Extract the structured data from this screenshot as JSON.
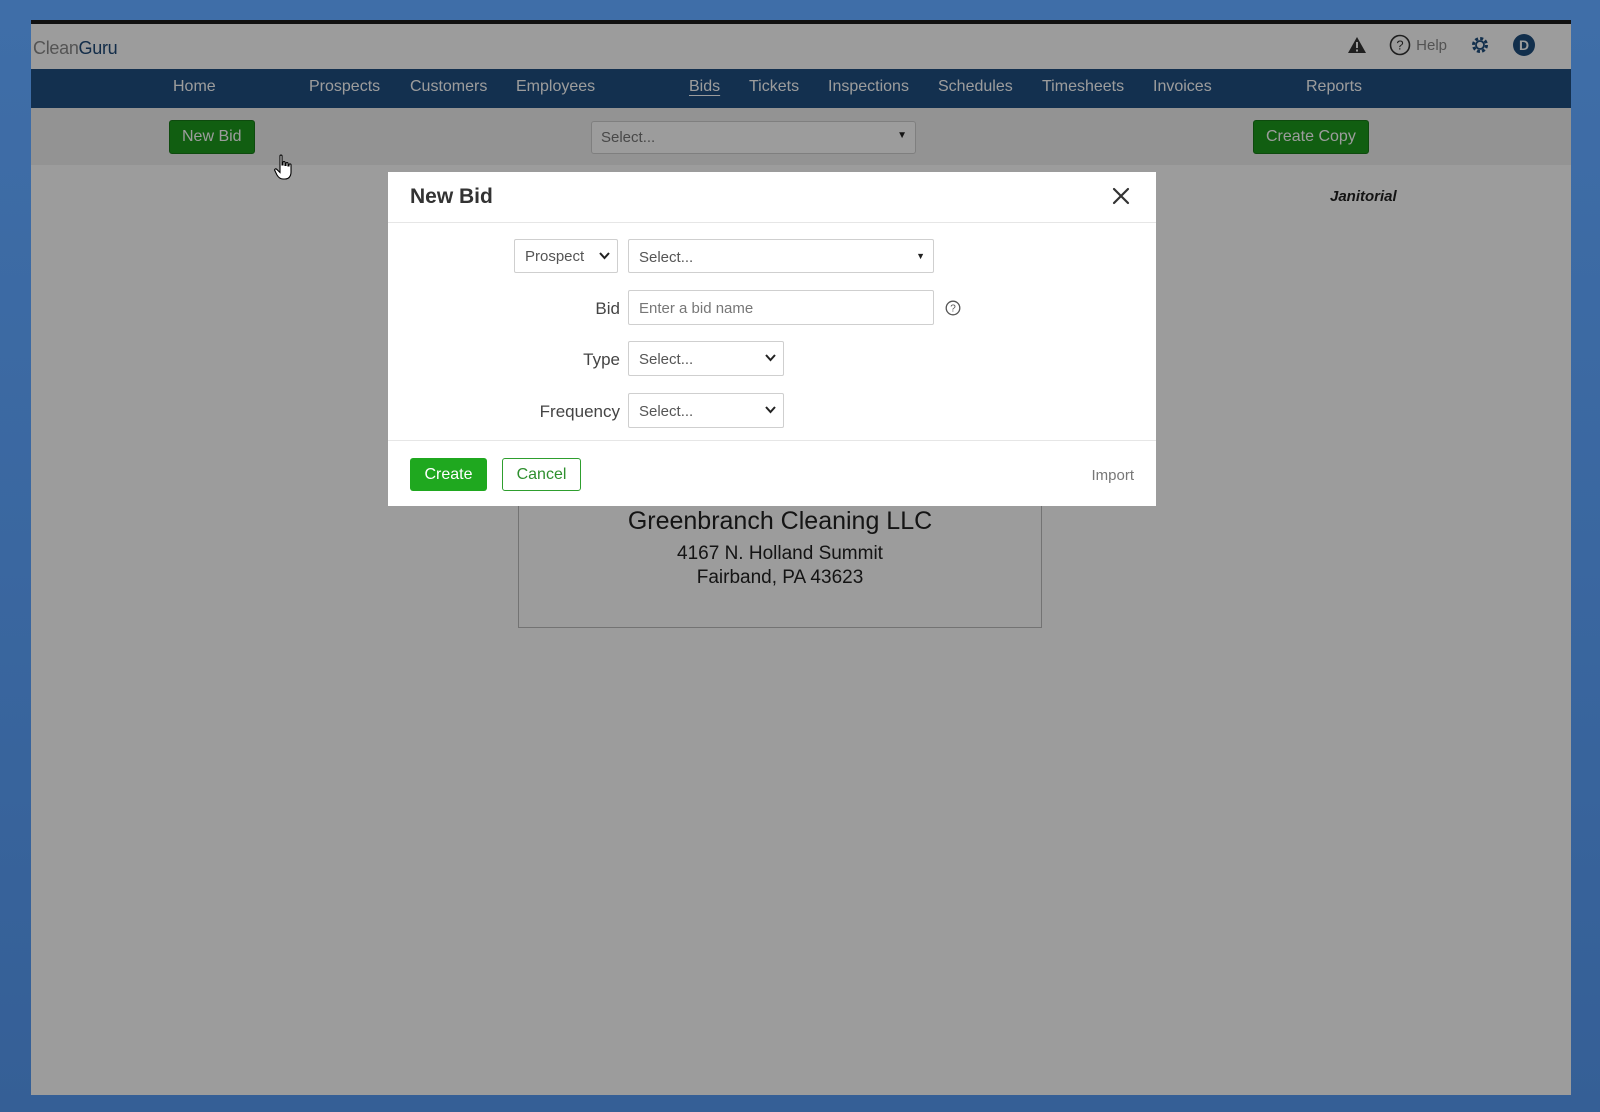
{
  "app": {
    "logo_part1": "Clean",
    "logo_part2": "Guru",
    "help_label": "Help",
    "avatar_initial": "D"
  },
  "nav": {
    "items": [
      {
        "label": "Home"
      },
      {
        "label": "Prospects"
      },
      {
        "label": "Customers"
      },
      {
        "label": "Employees"
      },
      {
        "label": "Bids",
        "active": true
      },
      {
        "label": "Tickets"
      },
      {
        "label": "Inspections"
      },
      {
        "label": "Schedules"
      },
      {
        "label": "Timesheets"
      },
      {
        "label": "Invoices"
      },
      {
        "label": "Reports"
      }
    ]
  },
  "toolbar": {
    "new_bid_label": "New Bid",
    "bid_select_value": "Select...",
    "create_copy_label": "Create Copy"
  },
  "content": {
    "janitorial_label": "Janitorial",
    "company_name": "Greenbranch Cleaning LLC",
    "address_line1": "4167 N. Holland Summit",
    "address_line2": "Fairband, PA 43623"
  },
  "modal": {
    "title": "New Bid",
    "source_type_value": "Prospect",
    "source_select_value": "Select...",
    "bid_label": "Bid",
    "bid_placeholder": "Enter a bid name",
    "type_label": "Type",
    "type_value": "Select...",
    "frequency_label": "Frequency",
    "frequency_value": "Select...",
    "create_label": "Create",
    "cancel_label": "Cancel",
    "import_label": "Import"
  },
  "colors": {
    "nav_bg": "#1f4f82",
    "button_green": "#1c9a1c",
    "overlay": "rgba(0,0,0,0.39)"
  }
}
